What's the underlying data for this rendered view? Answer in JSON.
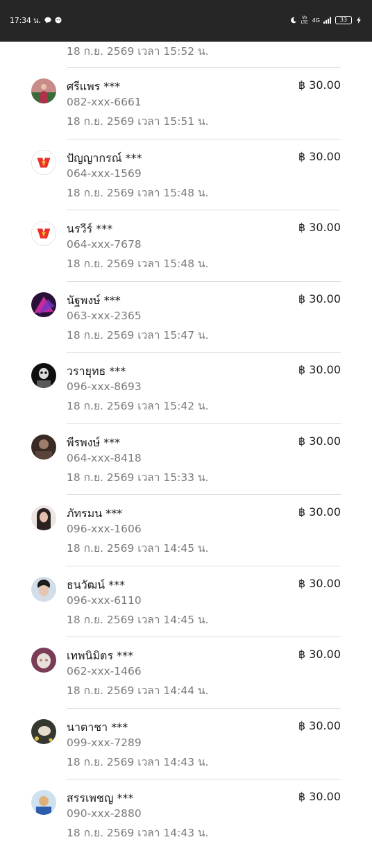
{
  "status_bar": {
    "time": "17:34 น.",
    "icons_left": [
      "line-icon",
      "app-notification-icon"
    ],
    "icons_right": [
      "moon-icon",
      "volte-icon",
      "signal-icon",
      "charging-icon"
    ],
    "volte_text": "Vo LTE",
    "network_text": "4G",
    "battery_level": "33"
  },
  "transactions": [
    {
      "name": "",
      "amount": "",
      "phone": "",
      "datetime": "18 ก.ย. 2569 เวลา 15:52 น.",
      "partial": true
    },
    {
      "name": "ศรีแพร ***",
      "amount": "฿ 30.00",
      "phone": "082-xxx-6661",
      "datetime": "18 ก.ย. 2569 เวลา 15:51 น.",
      "avatar": "photo-avatar",
      "avatar_colors": [
        "#c98a8a",
        "#3c6b3a",
        "#b1304a"
      ]
    },
    {
      "name": "ปัญญากรณ์ ***",
      "amount": "฿ 30.00",
      "phone": "064-xxx-1569",
      "datetime": "18 ก.ย. 2569 เวลา 15:48 น.",
      "avatar": "brand-logo-avatar",
      "avatar_colors": [
        "#ffffff",
        "#e8312a",
        "#f6b51e"
      ]
    },
    {
      "name": "นรวีร์ ***",
      "amount": "฿ 30.00",
      "phone": "064-xxx-7678",
      "datetime": "18 ก.ย. 2569 เวลา 15:48 น.",
      "avatar": "brand-logo-avatar",
      "avatar_colors": [
        "#ffffff",
        "#e8312a",
        "#f6b51e"
      ]
    },
    {
      "name": "นัฐพงษ์ ***",
      "amount": "฿ 30.00",
      "phone": "063-xxx-2365",
      "datetime": "18 ก.ย. 2569 เวลา 15:47 น.",
      "avatar": "photo-avatar",
      "avatar_colors": [
        "#2a1138",
        "#c52b9a",
        "#6f37c7"
      ]
    },
    {
      "name": "วรายุทธ ***",
      "amount": "฿ 30.00",
      "phone": "096-xxx-8693",
      "datetime": "18 ก.ย. 2569 เวลา 15:42 น.",
      "avatar": "photo-avatar",
      "avatar_colors": [
        "#0f0f0f",
        "#d9d9d9",
        "#5a5a5a"
      ]
    },
    {
      "name": "พีรพงษ์ ***",
      "amount": "฿ 30.00",
      "phone": "064-xxx-8418",
      "datetime": "18 ก.ย. 2569 เวลา 15:33 น.",
      "avatar": "photo-avatar",
      "avatar_colors": [
        "#3a2a24",
        "#9c7c6a",
        "#5b423a"
      ]
    },
    {
      "name": "ภัทรมน ***",
      "amount": "฿ 30.00",
      "phone": "096-xxx-1606",
      "datetime": "18 ก.ย. 2569 เวลา 14:45 น.",
      "avatar": "photo-avatar",
      "avatar_colors": [
        "#ece6e2",
        "#2b2120",
        "#e3bfb0"
      ]
    },
    {
      "name": "ธนวัฒน์ ***",
      "amount": "฿ 30.00",
      "phone": "096-xxx-6110",
      "datetime": "18 ก.ย. 2569 เวลา 14:45 น.",
      "avatar": "photo-avatar",
      "avatar_colors": [
        "#d2dde8",
        "#1a1a1a",
        "#e6c4ad"
      ]
    },
    {
      "name": "เทพนิมิตร ***",
      "amount": "฿ 30.00",
      "phone": "062-xxx-1466",
      "datetime": "18 ก.ย. 2569 เวลา 14:44 น.",
      "avatar": "photo-avatar",
      "avatar_colors": [
        "#7a3b57",
        "#e7e0da",
        "#b98a7c"
      ]
    },
    {
      "name": "นาตาชา ***",
      "amount": "฿ 30.00",
      "phone": "099-xxx-7289",
      "datetime": "18 ก.ย. 2569 เวลา 14:43 น.",
      "avatar": "photo-avatar",
      "avatar_colors": [
        "#35382e",
        "#e7dccb",
        "#e2c43c"
      ]
    },
    {
      "name": "สรรเพชญ ***",
      "amount": "฿ 30.00",
      "phone": "090-xxx-2880",
      "datetime": "18 ก.ย. 2569 เวลา 14:43 น.",
      "avatar": "photo-avatar",
      "avatar_colors": [
        "#cfe0ee",
        "#2d5da8",
        "#e1b07a"
      ]
    }
  ]
}
